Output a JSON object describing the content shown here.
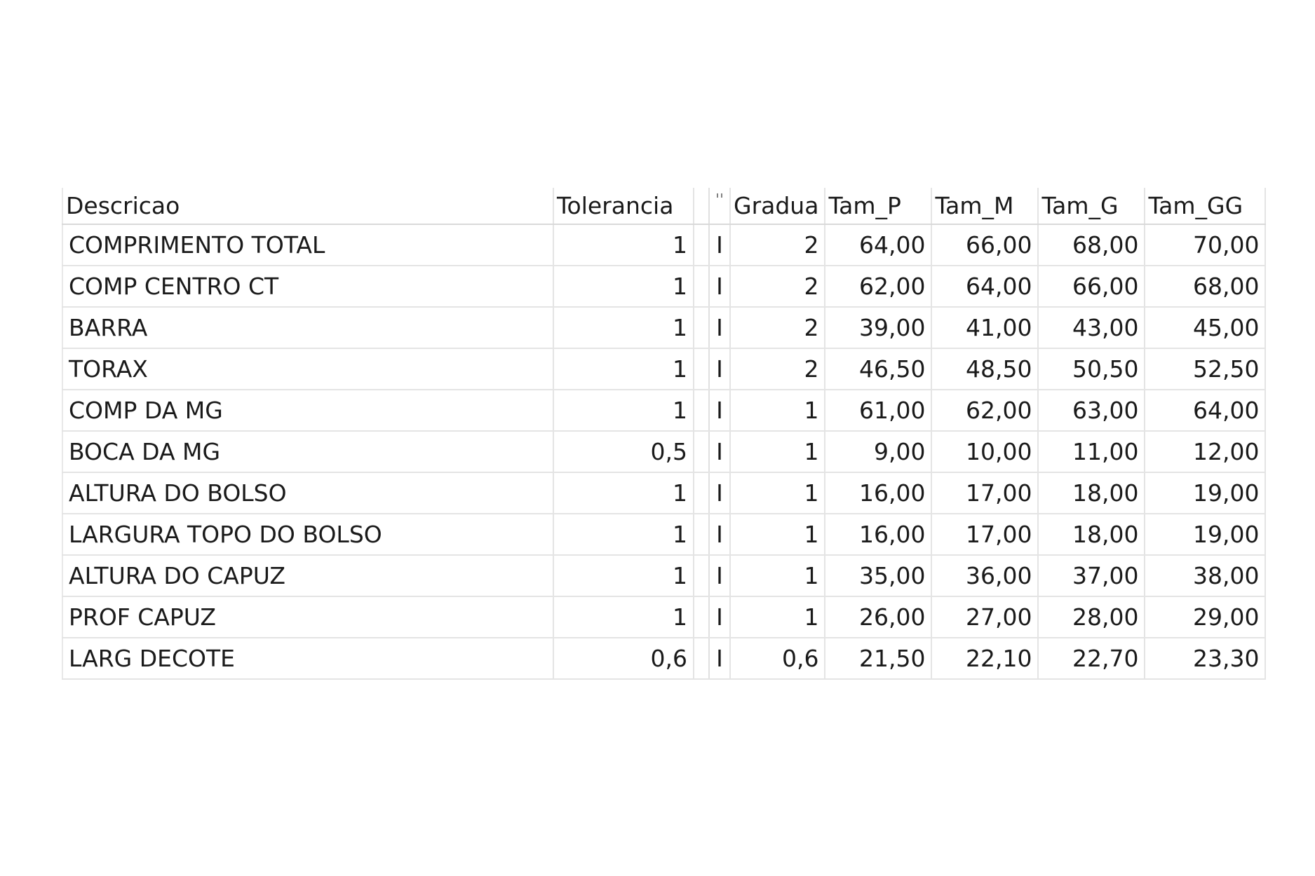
{
  "grid": {
    "columns": [
      "Descricao",
      "Tolerancia",
      "",
      "",
      "Gradua",
      "Tam_P",
      "Tam_M",
      "Tam_G",
      "Tam_GG"
    ],
    "rows": [
      {
        "descricao": "COMPRIMENTO TOTAL",
        "tolerancia": "1",
        "flag": "I",
        "graduacao": "2",
        "tam_p": "64,00",
        "tam_m": "66,00",
        "tam_g": "68,00",
        "tam_gg": "70,00"
      },
      {
        "descricao": "COMP CENTRO CT",
        "tolerancia": "1",
        "flag": "I",
        "graduacao": "2",
        "tam_p": "62,00",
        "tam_m": "64,00",
        "tam_g": "66,00",
        "tam_gg": "68,00"
      },
      {
        "descricao": "BARRA",
        "tolerancia": "1",
        "flag": "I",
        "graduacao": "2",
        "tam_p": "39,00",
        "tam_m": "41,00",
        "tam_g": "43,00",
        "tam_gg": "45,00"
      },
      {
        "descricao": "TORAX",
        "tolerancia": "1",
        "flag": "I",
        "graduacao": "2",
        "tam_p": "46,50",
        "tam_m": "48,50",
        "tam_g": "50,50",
        "tam_gg": "52,50"
      },
      {
        "descricao": "COMP DA MG",
        "tolerancia": "1",
        "flag": "I",
        "graduacao": "1",
        "tam_p": "61,00",
        "tam_m": "62,00",
        "tam_g": "63,00",
        "tam_gg": "64,00"
      },
      {
        "descricao": "BOCA DA MG",
        "tolerancia": "0,5",
        "flag": "I",
        "graduacao": "1",
        "tam_p": "9,00",
        "tam_m": "10,00",
        "tam_g": "11,00",
        "tam_gg": "12,00"
      },
      {
        "descricao": "ALTURA DO BOLSO",
        "tolerancia": "1",
        "flag": "I",
        "graduacao": "1",
        "tam_p": "16,00",
        "tam_m": "17,00",
        "tam_g": "18,00",
        "tam_gg": "19,00"
      },
      {
        "descricao": "LARGURA TOPO DO BOLSO",
        "tolerancia": "1",
        "flag": "I",
        "graduacao": "1",
        "tam_p": "16,00",
        "tam_m": "17,00",
        "tam_g": "18,00",
        "tam_gg": "19,00"
      },
      {
        "descricao": "ALTURA DO CAPUZ",
        "tolerancia": "1",
        "flag": "I",
        "graduacao": "1",
        "tam_p": "35,00",
        "tam_m": "36,00",
        "tam_g": "37,00",
        "tam_gg": "38,00"
      },
      {
        "descricao": "PROF CAPUZ",
        "tolerancia": "1",
        "flag": "I",
        "graduacao": "1",
        "tam_p": "26,00",
        "tam_m": "27,00",
        "tam_g": "28,00",
        "tam_gg": "29,00"
      },
      {
        "descricao": "LARG DECOTE",
        "tolerancia": "0,6",
        "flag": "I",
        "graduacao": "0,6",
        "tam_p": "21,50",
        "tam_m": "22,10",
        "tam_g": "22,70",
        "tam_gg": "23,30"
      }
    ]
  }
}
